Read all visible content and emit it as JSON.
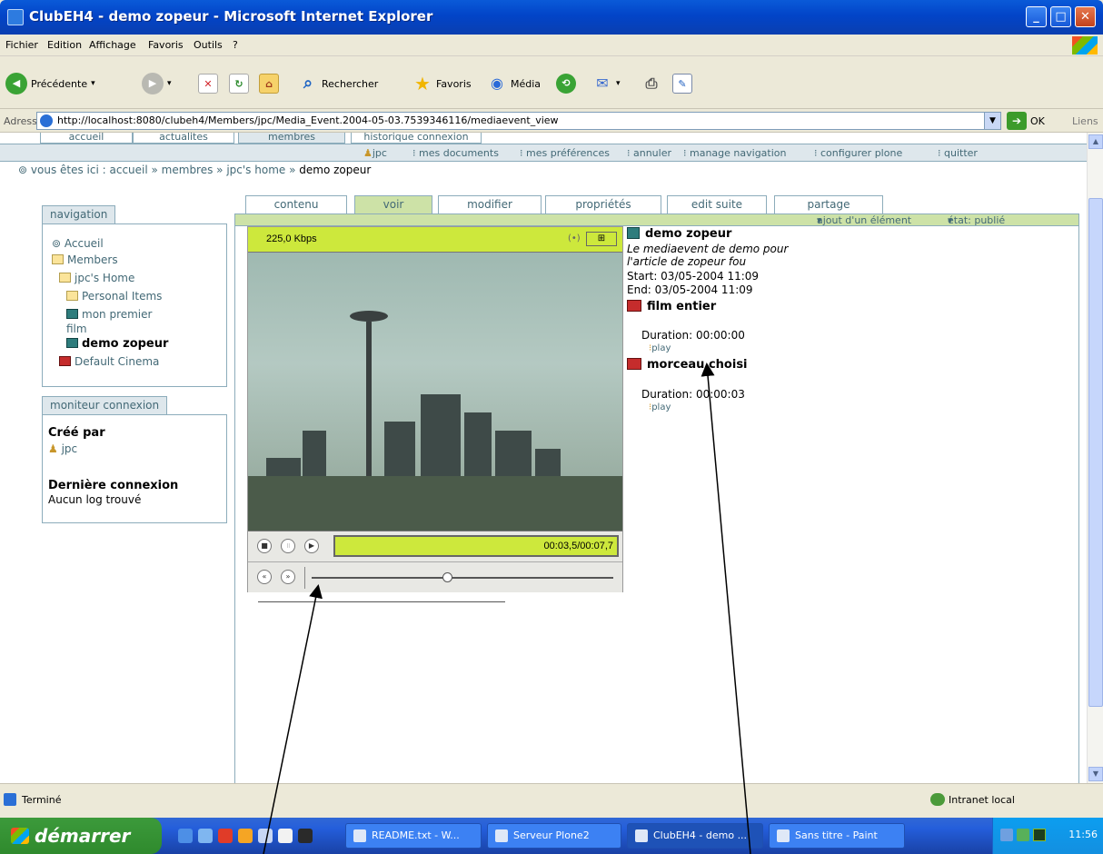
{
  "window": {
    "title": "ClubEH4 - demo zopeur - Microsoft Internet Explorer"
  },
  "menu": [
    "Fichier",
    "Edition",
    "Affichage",
    "Favoris",
    "Outils",
    "?"
  ],
  "toolbar": {
    "back": "Précédente",
    "search": "Rechercher",
    "favorites": "Favoris",
    "media": "Média"
  },
  "address": {
    "label": "Adresse",
    "url": "http://localhost:8080/clubeh4/Members/jpc/Media_Event.2004-05-03.7539346116/mediaevent_view",
    "go": "OK",
    "links": "Liens"
  },
  "portal_tabs": [
    "accueil",
    "actualites",
    "membres",
    "historique connexion"
  ],
  "personal_bar": [
    "jpc",
    "mes documents",
    "mes préférences",
    "annuler",
    "manage navigation",
    "configurer plone",
    "quitter"
  ],
  "breadcrumb": {
    "prefix": "vous êtes ici :",
    "path": "accueil » membres » jpc's home »",
    "current": "demo zopeur"
  },
  "navigation": {
    "title": "navigation",
    "items": [
      "Accueil",
      "Members",
      "jpc's Home",
      "Personal Items",
      "mon premier",
      "film",
      "demo zopeur",
      "Default Cinema"
    ]
  },
  "monitor": {
    "title": "moniteur connexion",
    "created_label": "Créé par",
    "created_user": "jpc",
    "last_label": "Dernière connexion",
    "last_value": "Aucun log trouvé"
  },
  "content_tabs": [
    "contenu",
    "voir",
    "modifier",
    "propriétés",
    "edit suite",
    "partage"
  ],
  "actions": {
    "add": "ajout d'un élément",
    "state": "état: publié"
  },
  "player": {
    "bitrate": "225,0 Kbps",
    "time": "00:03,5/00:07,7",
    "progress": 0.45
  },
  "event": {
    "title": "demo zopeur",
    "desc_line1": "Le mediaevent de demo pour",
    "desc_line2": "l'article de zopeur fou",
    "start": "Start: 03/05-2004 11:09",
    "end": "End: 03/05-2004 11:09",
    "clips": [
      {
        "title": "film entier",
        "duration": "Duration: 00:00:00",
        "play": "play"
      },
      {
        "title": "morceau choisi",
        "duration": "Duration: 00:00:03",
        "play": "play"
      }
    ]
  },
  "status": {
    "text": "Terminé",
    "zone": "Intranet local"
  },
  "taskbar": {
    "start": "démarrer",
    "tasks": [
      "README.txt - W...",
      "Serveur Plone2",
      "ClubEH4 - demo ...",
      "Sans titre - Paint"
    ],
    "clock": "11:56"
  },
  "colors": {
    "ie_blue": "#0a5ad8",
    "plone_link": "#436976",
    "plone_border": "#8cacbb",
    "plone_green": "#cde2a7",
    "player_lime": "#cde83c"
  }
}
